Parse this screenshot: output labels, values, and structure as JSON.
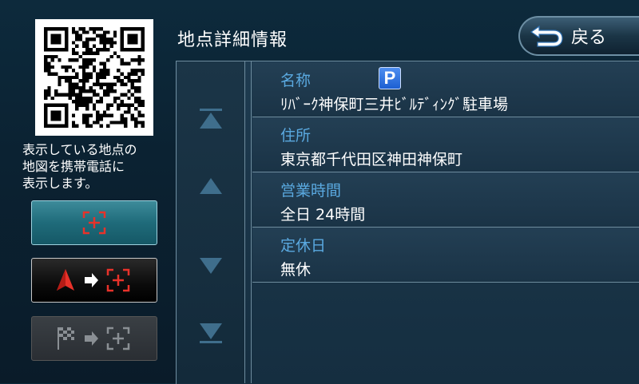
{
  "header": {
    "title": "地点詳細情報",
    "back_label": "戻る"
  },
  "qr": {
    "caption": "表示している地点の\n地図を携帯電話に\n表示します。"
  },
  "details": [
    {
      "label": "名称",
      "value": "ﾘﾊﾞｰｸ神保町三井ﾋﾞﾙﾃﾞｨﾝｸﾞ駐車場",
      "badge": "P"
    },
    {
      "label": "住所",
      "value": "東京都千代田区神田神保町"
    },
    {
      "label": "営業時間",
      "value": "全日 24時間"
    },
    {
      "label": "定休日",
      "value": "無休"
    }
  ],
  "icons": {
    "map_center": "map-crosshair-icon",
    "route": "car-to-crosshair-icon",
    "goal": "flag-to-crosshair-icon",
    "scroll_top": "scroll-top-icon",
    "scroll_up": "scroll-up-icon",
    "scroll_down": "scroll-down-icon",
    "scroll_bottom": "scroll-bottom-icon",
    "back": "back-arrow-icon"
  },
  "colors": {
    "label": "#5aa9e0",
    "accent_red": "#e8322a",
    "parking_blue": "#1c5fd2"
  }
}
